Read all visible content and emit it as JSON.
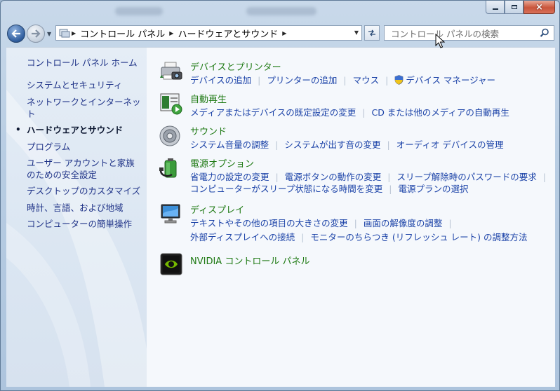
{
  "window": {
    "close_symbol": "×"
  },
  "address_bar": {
    "crumbs": [
      "コントロール パネル",
      "ハードウェアとサウンド"
    ]
  },
  "search": {
    "placeholder": "コントロール パネルの検索"
  },
  "sidebar": {
    "home": "コントロール パネル ホーム",
    "items": [
      "システムとセキュリティ",
      "ネットワークとインターネット",
      "ハードウェアとサウンド",
      "プログラム",
      "ユーザー アカウントと家族のための安全設定",
      "デスクトップのカスタマイズ",
      "時計、言語、および地域",
      "コンピューターの簡単操作"
    ],
    "current_bullet": "•"
  },
  "categories": {
    "devices": {
      "title": "デバイスとプリンター",
      "icon": "printer-camera-icon",
      "links": [
        "デバイスの追加",
        "プリンターの追加",
        "マウス",
        "デバイス マネージャー"
      ]
    },
    "autoplay": {
      "title": "自動再生",
      "icon": "autoplay-icon",
      "links": [
        "メディアまたはデバイスの既定設定の変更",
        "CD または他のメディアの自動再生"
      ]
    },
    "sound": {
      "title": "サウンド",
      "icon": "speaker-icon",
      "links": [
        "システム音量の調整",
        "システムが出す音の変更",
        "オーディオ デバイスの管理"
      ]
    },
    "power": {
      "title": "電源オプション",
      "icon": "battery-plug-icon",
      "links": [
        "省電力の設定の変更",
        "電源ボタンの動作の変更",
        "スリープ解除時のパスワードの要求",
        "コンピューターがスリープ状態になる時間を変更",
        "電源プランの選択"
      ]
    },
    "display": {
      "title": "ディスプレイ",
      "icon": "monitor-icon",
      "links": [
        "テキストやその他の項目の大きさの変更",
        "画面の解像度の調整",
        "外部ディスプレイへの接続",
        "モニターのちらつき (リフレッシュ レート) の調整方法"
      ]
    },
    "nvidia": {
      "title": "NVIDIA コントロール パネル",
      "icon": "nvidia-icon"
    }
  },
  "colors": {
    "category_title": "#1f7a14",
    "link": "#1c43a8",
    "sidebar_link": "#1e3287"
  }
}
